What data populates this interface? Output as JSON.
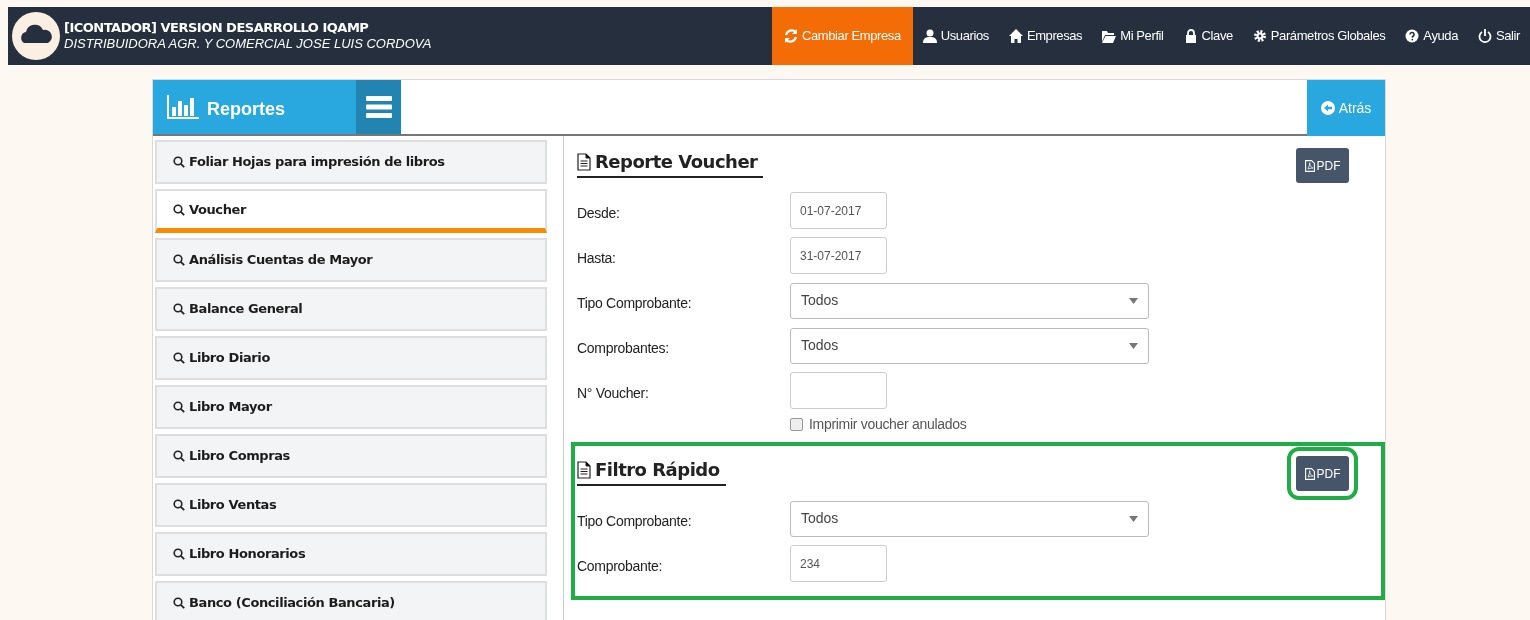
{
  "header": {
    "title": "[ICONTADOR] VERSION DESARROLLO IQAMP",
    "subtitle": "DISTRIBUIDORA AGR. Y COMERCIAL JOSE LUIS CORDOVA",
    "nav": [
      {
        "kind": "refresh",
        "label": "Cambiar Empresa",
        "selected": true
      },
      {
        "kind": "user",
        "label": "Usuarios",
        "selected": false
      },
      {
        "kind": "home",
        "label": "Empresas",
        "selected": false
      },
      {
        "kind": "folder",
        "label": "Mi Perfil",
        "selected": false
      },
      {
        "kind": "lock",
        "label": "Clave",
        "selected": false
      },
      {
        "kind": "gear",
        "label": "Parámetros Globales",
        "selected": false
      },
      {
        "kind": "help",
        "label": "Ayuda",
        "selected": false
      },
      {
        "kind": "power",
        "label": "Salir",
        "selected": false
      }
    ]
  },
  "panel": {
    "title": "Reportes",
    "back_button": "Atrás"
  },
  "sidebar": {
    "items": [
      {
        "label": "Foliar Hojas para impresión de libros",
        "selected": false
      },
      {
        "label": "Voucher",
        "selected": true
      },
      {
        "label": "Análisis Cuentas de Mayor",
        "selected": false
      },
      {
        "label": "Balance General",
        "selected": false
      },
      {
        "label": "Libro Diario",
        "selected": false
      },
      {
        "label": "Libro Mayor",
        "selected": false
      },
      {
        "label": "Libro Compras",
        "selected": false
      },
      {
        "label": "Libro Ventas",
        "selected": false
      },
      {
        "label": "Libro Honorarios",
        "selected": false
      },
      {
        "label": "Banco (Conciliación Bancaria)",
        "selected": false
      }
    ]
  },
  "sections": [
    {
      "title": "Reporte Voucher",
      "pdf_button": "PDF",
      "highlighted": false,
      "fields": [
        {
          "kind": "input",
          "label": "Desde:",
          "value": "01-07-2017"
        },
        {
          "kind": "input",
          "label": "Hasta:",
          "value": "31-07-2017"
        },
        {
          "kind": "select",
          "label": "Tipo Comprobante:",
          "value": "Todos"
        },
        {
          "kind": "select",
          "label": "Comprobantes:",
          "value": "Todos"
        },
        {
          "kind": "input",
          "label": "N° Voucher:"
        },
        {
          "kind": "checkbox",
          "label": "Imprimir voucher anulados",
          "checked": false
        }
      ]
    },
    {
      "title": "Filtro Rápido",
      "pdf_button": "PDF",
      "highlighted": true,
      "fields": [
        {
          "kind": "select",
          "label": "Tipo Comprobante:",
          "value": "Todos"
        },
        {
          "kind": "input",
          "label": "Comprobante:",
          "value": "234"
        }
      ]
    }
  ]
}
